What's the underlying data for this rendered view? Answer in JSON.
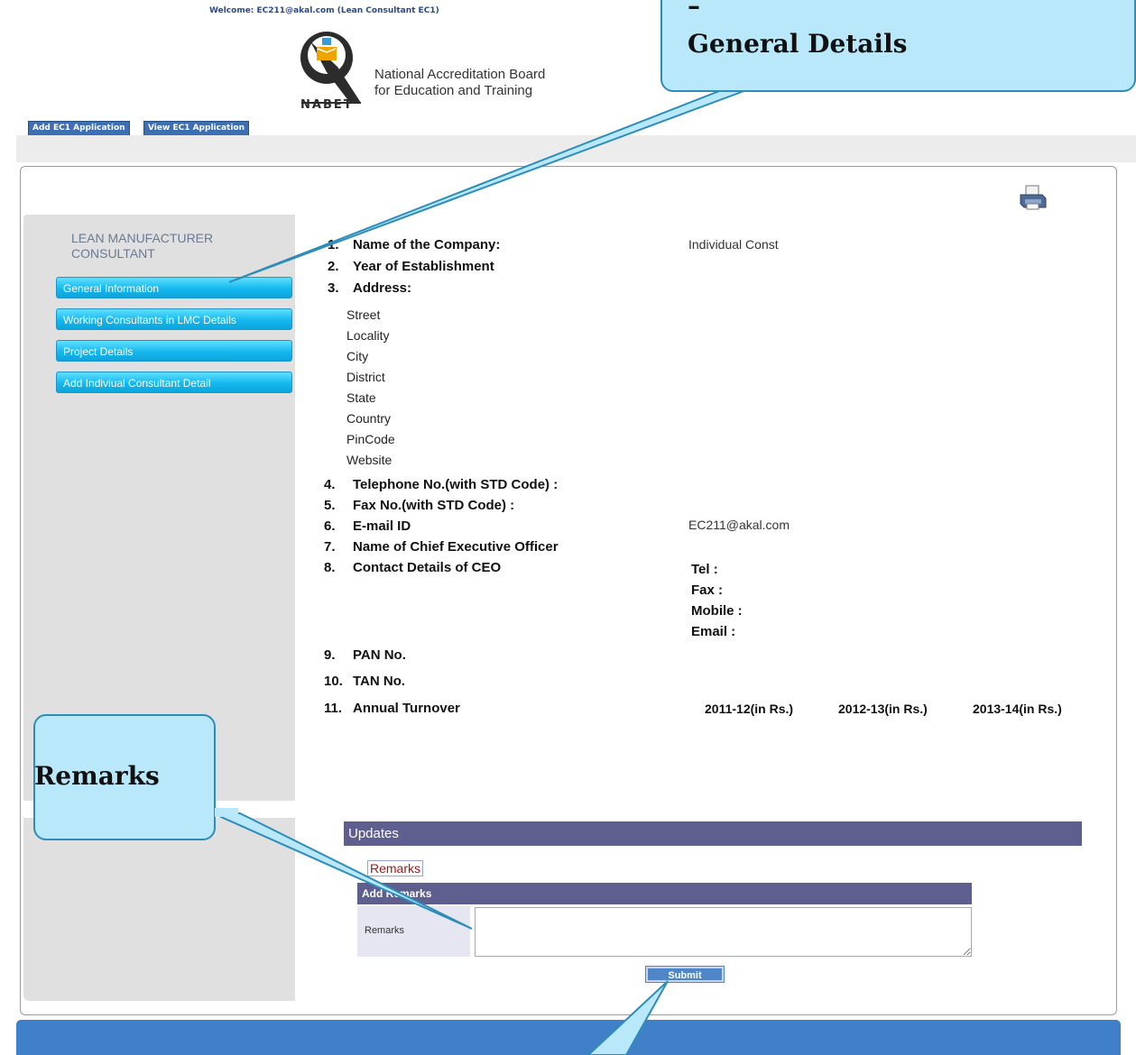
{
  "header": {
    "welcome": "Welcome: EC211@akal.com (Lean Consultant EC1)",
    "logo_line1": "National Accreditation Board",
    "logo_line2": "for Education and Training",
    "logo_wordmark": "NABET",
    "buttons": [
      "Add EC1 Application",
      "View EC1 Application"
    ]
  },
  "sidebar": {
    "title": "LEAN MANUFACTURER CONSULTANT",
    "items": [
      {
        "label": "General Information"
      },
      {
        "label": "Working Consultants in LMC Details"
      },
      {
        "label": "Project Details"
      },
      {
        "label": "Add Indiviual Consultant Detail"
      }
    ]
  },
  "form": {
    "items": [
      {
        "num": "1.",
        "label": "Name of the Company:",
        "value": "Individual Const"
      },
      {
        "num": "2.",
        "label": "Year of Establishment"
      },
      {
        "num": "3.",
        "label": "Address:"
      },
      {
        "num": "4.",
        "label": "Telephone No.(with STD Code) :"
      },
      {
        "num": "5.",
        "label": "Fax No.(with STD Code) :"
      },
      {
        "num": "6.",
        "label": "E-mail ID",
        "value": "EC211@akal.com"
      },
      {
        "num": "7.",
        "label": "Name of Chief Executive Officer"
      },
      {
        "num": "8.",
        "label": "Contact Details of CEO"
      },
      {
        "num": "9.",
        "label": "PAN No."
      },
      {
        "num": "10.",
        "label": "TAN No."
      },
      {
        "num": "11.",
        "label": "Annual Turnover"
      }
    ],
    "address_fields": [
      "Street",
      "Locality",
      "City",
      "District",
      "State",
      "Country",
      "PinCode",
      "Website"
    ],
    "ceo_contact_fields": [
      "Tel :",
      "Fax :",
      "Mobile :",
      "Email :"
    ],
    "turnover_years": [
      "2011-12(in Rs.)",
      "2012-13(in Rs.)",
      "2013-14(in Rs.)"
    ]
  },
  "updates": {
    "title": "Updates",
    "remarks_link": "Remarks",
    "add_remarks_header": "Add Remarks",
    "remarks_label": "Remarks",
    "remarks_value": "",
    "submit_label": "Submit"
  },
  "callouts": {
    "general_dash": "–",
    "general": "General Details",
    "remarks": "Remarks"
  },
  "colors": {
    "nav_button": "#14b8ee",
    "header_bar": "#5f5f8f",
    "footer": "#3f80c8",
    "callout_fill": "#b9e8fb"
  }
}
